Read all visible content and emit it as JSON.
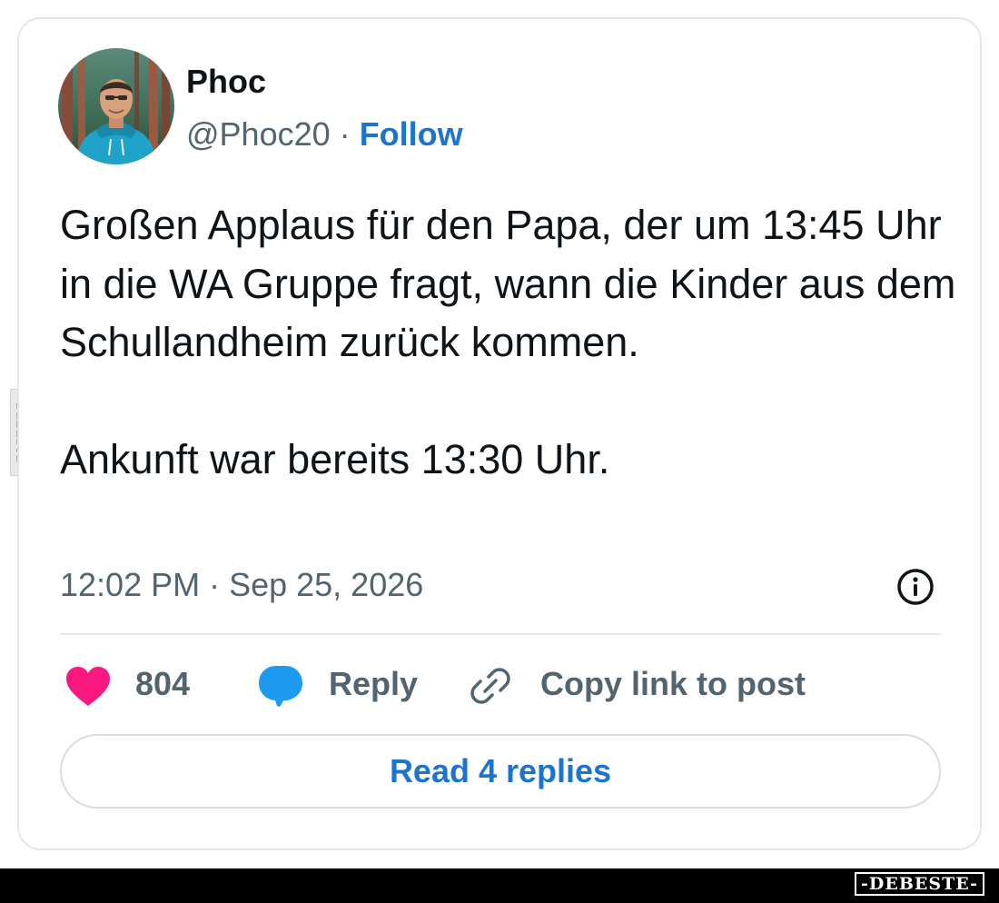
{
  "author": {
    "name": "Phoc",
    "handle": "@Phoc20",
    "separator": "·",
    "follow_label": "Follow"
  },
  "tweet": {
    "paragraphs": [
      "Großen Applaus für den Papa, der um 13:45 Uhr in die WA Gruppe fragt, wann die Kinder aus dem Schullandheim zurück kommen.",
      "Ankunft war bereits 13:30 Uhr."
    ],
    "timestamp": "12:02 PM · Sep 25, 2026"
  },
  "actions": {
    "likes_count": "804",
    "reply_label": "Reply",
    "copy_link_label": "Copy link to post"
  },
  "read_replies_label": "Read 4 replies",
  "watermark": {
    "side_text": "DEBESTE",
    "footer_text": "-DEBESTE-"
  },
  "colors": {
    "accent": "#1d74d0",
    "heart": "#f91880",
    "reply_icon": "#1d9bf0",
    "muted_text": "#536471"
  },
  "icons": [
    "info-icon",
    "heart-icon",
    "reply-bubble-icon",
    "link-icon"
  ]
}
